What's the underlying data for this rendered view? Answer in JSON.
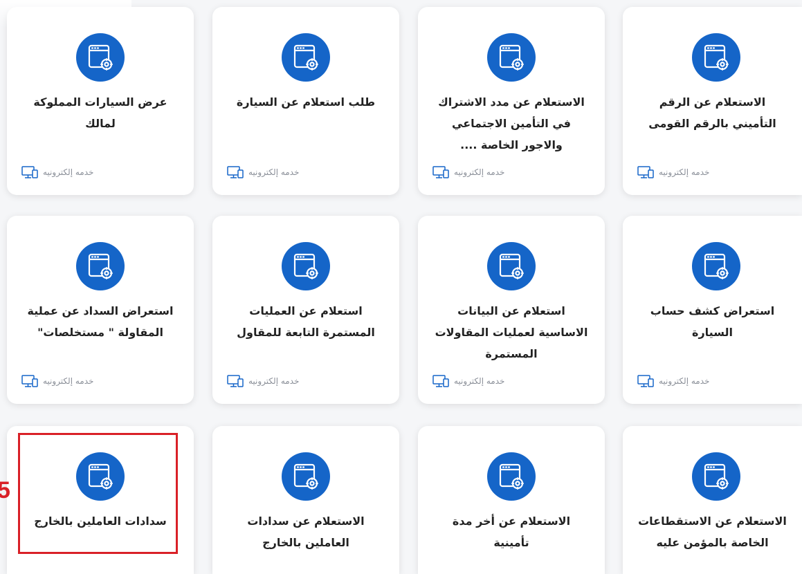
{
  "colors": {
    "accent": "#1565c8",
    "highlight": "#d92027"
  },
  "services": [
    {
      "title": "عرض السيارات المملوكة لمالك",
      "badge": "خدمه إلكترونيه",
      "icon": "browser-gear-icon"
    },
    {
      "title": "طلب استعلام عن السيارة",
      "badge": "خدمه إلكترونيه",
      "icon": "browser-gear-icon"
    },
    {
      "title": "الاستعلام عن مدد الاشتراك في التأمين الاجتماعي والاجور الخاصة ....",
      "badge": "خدمه إلكترونيه",
      "icon": "browser-gear-icon"
    },
    {
      "title": "الاستعلام عن الرقم التأميني بالرقم القومى",
      "badge": "خدمه إلكترونيه",
      "icon": "browser-gear-icon"
    },
    {
      "title": "استعراض السداد عن عملية المقاولة \" مستخلصات\"",
      "badge": "خدمه إلكترونيه",
      "icon": "browser-gear-icon"
    },
    {
      "title": "استعلام عن العمليات المستمرة التابعة للمقاول",
      "badge": "خدمه إلكترونيه",
      "icon": "browser-gear-icon"
    },
    {
      "title": "استعلام عن البيانات الاساسية لعمليات المقاولات المستمرة",
      "badge": "خدمه إلكترونيه",
      "icon": "browser-gear-icon"
    },
    {
      "title": "استعراض كشف حساب السيارة",
      "badge": "خدمه إلكترونيه",
      "icon": "browser-gear-icon"
    },
    {
      "title": "سدادات العاملين بالخارج",
      "icon": "browser-gear-icon"
    },
    {
      "title": "الاستعلام عن سدادات العاملين بالخارج",
      "icon": "browser-gear-icon"
    },
    {
      "title": "الاستعلام عن أخر مدة تأمينية",
      "icon": "browser-gear-icon"
    },
    {
      "title": "الاستعلام عن الاستقطاعات الخاصة بالمؤمن عليه",
      "icon": "browser-gear-icon"
    }
  ],
  "annotation": {
    "step_number": "5"
  }
}
